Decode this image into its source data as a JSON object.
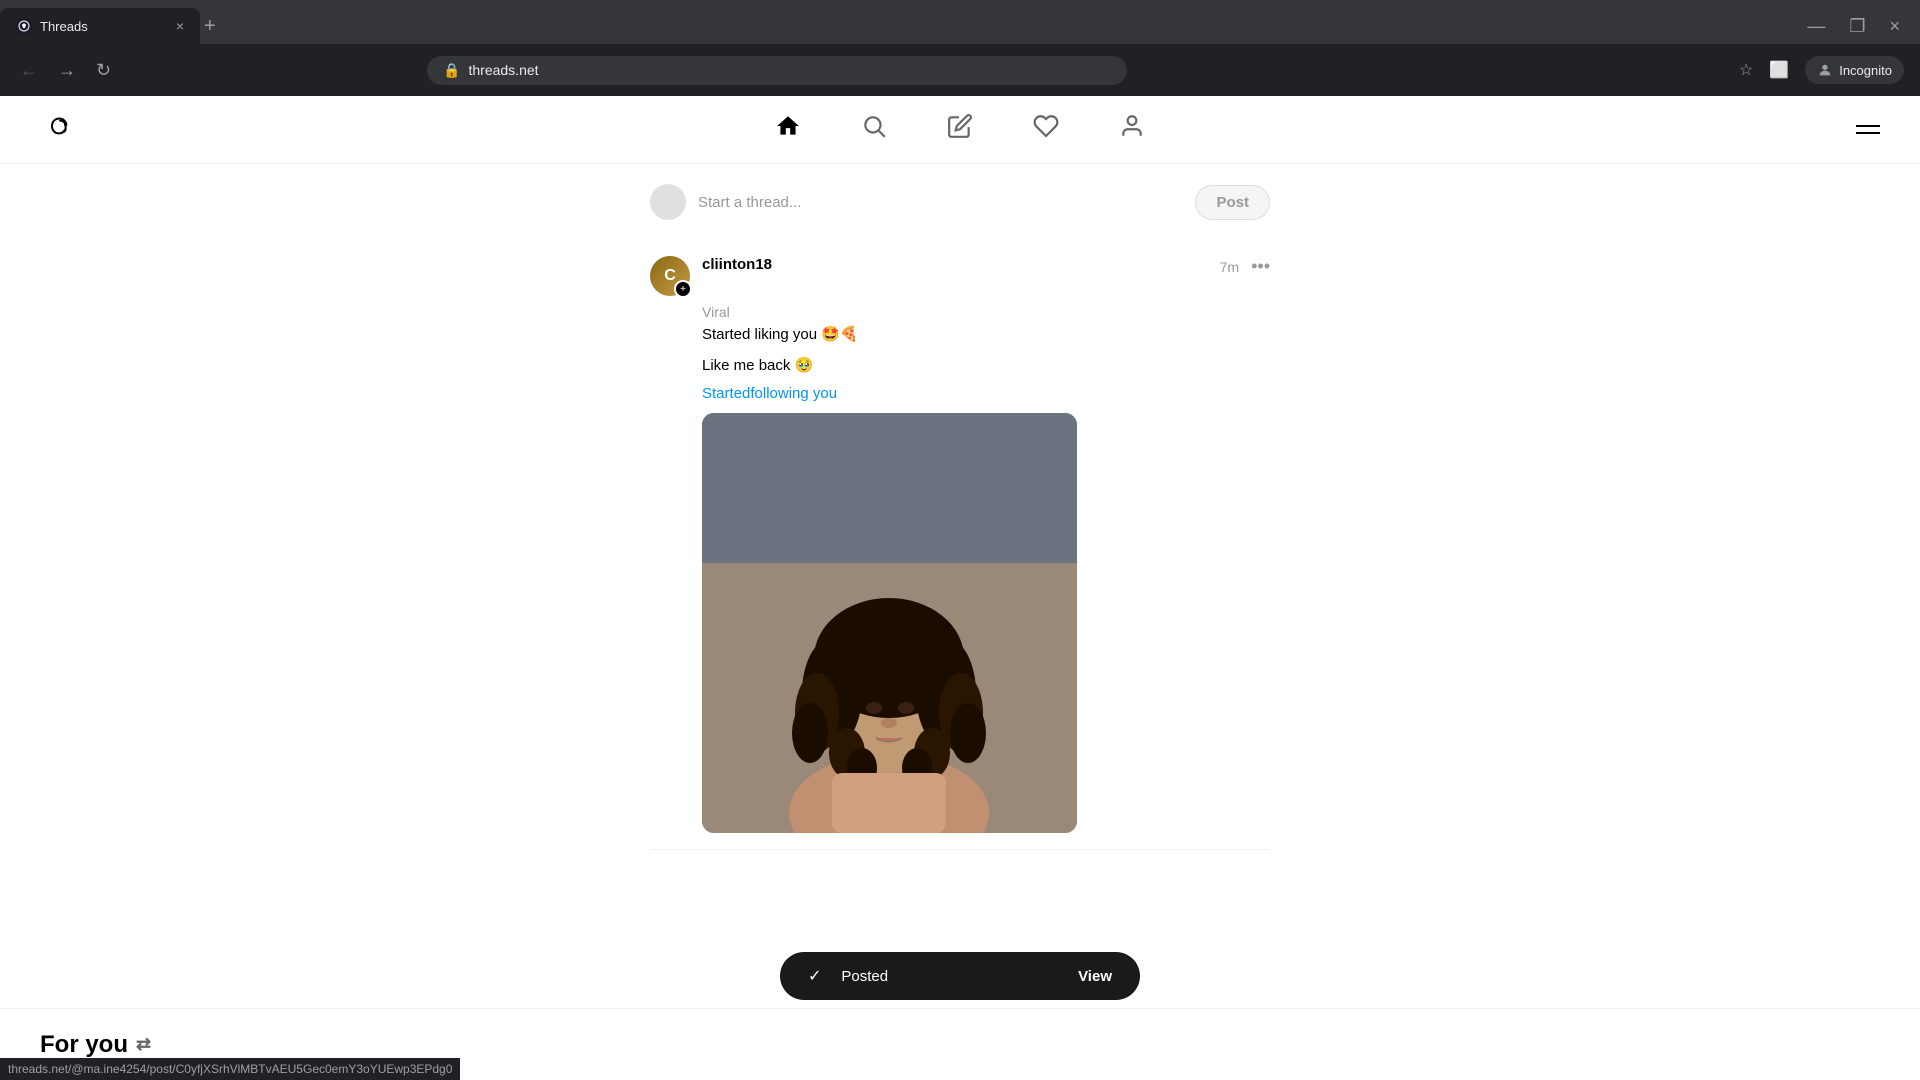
{
  "browser": {
    "tab_favicon": "T",
    "tab_title": "Threads",
    "tab_close": "×",
    "tab_new": "+",
    "window_minimize": "—",
    "window_restore": "❐",
    "window_close": "×",
    "nav_back": "←",
    "nav_forward": "→",
    "nav_refresh": "↻",
    "address_lock": "🔒",
    "address_url": "threads.net",
    "star_icon": "☆",
    "extensions_icon": "⬜",
    "incognito_label": "Incognito"
  },
  "page": {
    "title": "Threads",
    "logo_alt": "Threads logo"
  },
  "nav": {
    "home_icon": "home",
    "search_icon": "search",
    "compose_icon": "compose",
    "activity_icon": "heart",
    "profile_icon": "person"
  },
  "composer": {
    "placeholder": "Start a thread...",
    "post_button": "Post"
  },
  "post": {
    "username": "cliinton18",
    "time": "7m",
    "options": "•••",
    "label": "Viral",
    "text_line1": "Started liking you 🤩🍕",
    "text_line2": "Like me back 🥹",
    "link": "Startedfollowing you",
    "link_href": "Startedfollowing you"
  },
  "notification": {
    "check": "✓",
    "posted_label": "Posted",
    "view_label": "View"
  },
  "bottom": {
    "for_you_label": "For you",
    "refresh_icon": "⇄"
  },
  "status_bar": {
    "url": "threads.net/@ma.ine4254/post/C0yfjXSrhVlMBTvAEU5Gec0emY3oYUEwp3EPdg0"
  }
}
